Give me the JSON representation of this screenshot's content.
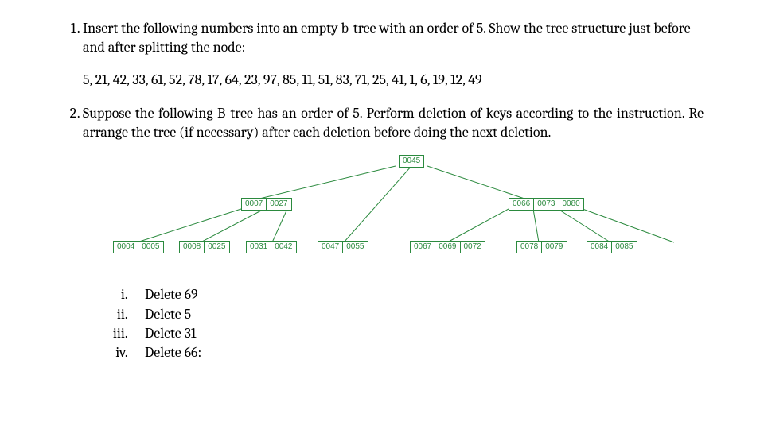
{
  "q1": {
    "text": "Insert the following numbers into an empty b-tree with an order of 5.  Show the tree structure just before and after splitting the node:",
    "numbers": "5, 21, 42, 33, 61, 52, 78, 17, 64, 23, 97, 85, 11, 51, 83, 71, 25, 41, 1, 6, 19, 12, 49"
  },
  "q2": {
    "text": "Suppose the following B-tree has an order of 5.  Perform deletion of keys according to the instruction.  Re-arrange the tree (if necessary) after each deletion before doing the next deletion.",
    "tree": {
      "root": [
        "0045"
      ],
      "mid_left": [
        "0007",
        "0027"
      ],
      "mid_right": [
        "0066",
        "0073",
        "0080"
      ],
      "leaf1": [
        "0004",
        "0005"
      ],
      "leaf2": [
        "0008",
        "0025"
      ],
      "leaf3": [
        "0031",
        "0042"
      ],
      "leaf4": [
        "0047",
        "0055"
      ],
      "leaf5": [
        "0067",
        "0069",
        "0072"
      ],
      "leaf6": [
        "0078",
        "0079"
      ],
      "leaf7": [
        "0084",
        "0085"
      ]
    },
    "deletions": {
      "i": "Delete 69",
      "ii": "Delete 5",
      "iii": "Delete 31",
      "iv": "Delete 66:"
    }
  }
}
